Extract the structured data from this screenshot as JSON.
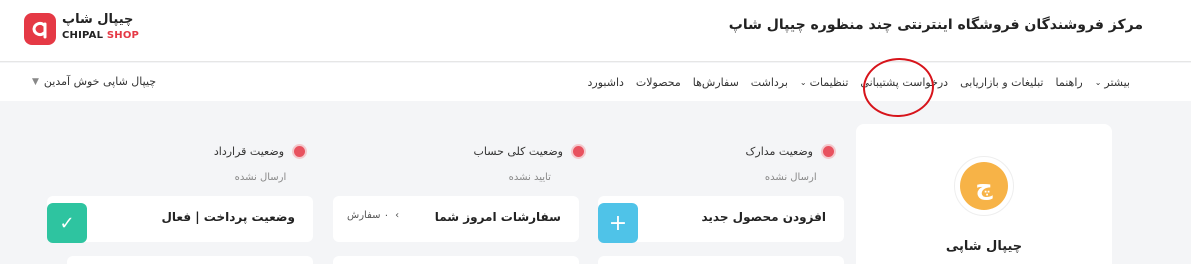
{
  "header": {
    "title": "مرکز فروشندگان فروشگاه اینترنتی چند منظوره چیپال شاپ",
    "logo_fa": "چیپال شاپ",
    "logo_en_a": "CHIPAL",
    "logo_en_b": "SHOP"
  },
  "nav": {
    "items": [
      {
        "label": "داشبورد",
        "chevron": false
      },
      {
        "label": "محصولات",
        "chevron": false
      },
      {
        "label": "سفارش‌ها",
        "chevron": false
      },
      {
        "label": "برداشت",
        "chevron": false
      },
      {
        "label": "تنظیمات",
        "chevron": true
      },
      {
        "label": "درخواست پشتیبانی",
        "chevron": false
      },
      {
        "label": "تبلیغات و بازاریابی",
        "chevron": false
      },
      {
        "label": "راهنما",
        "chevron": false
      },
      {
        "label": "بیشتر",
        "chevron": true
      }
    ],
    "greeting": "چیپال شاپی خوش آمدین"
  },
  "statuses": [
    {
      "label": "وضعیت مدارک",
      "value": "ارسال نشده"
    },
    {
      "label": "وضعیت کلی حساب",
      "value": "تایید نشده"
    },
    {
      "label": "وضعیت قرارداد",
      "value": "ارسال نشده"
    }
  ],
  "cards": {
    "add_product": {
      "title": "افزودن محصول جدید",
      "icon": "plus-icon"
    },
    "today_orders": {
      "title": "سفارشات امروز شما",
      "count_text": "۰ سفارش"
    },
    "payment_status": {
      "title": "وضعیت پرداخت | فعال",
      "icon": "check-icon"
    }
  },
  "profile": {
    "name": "چیپال شاپی",
    "avatar_letter": "چ"
  },
  "colors": {
    "accent": "#e53945",
    "dot": "#e8525f",
    "plus": "#4fc3e8",
    "check": "#2ec4a0",
    "avatar": "#f7b347",
    "annotation": "#d7141b"
  }
}
